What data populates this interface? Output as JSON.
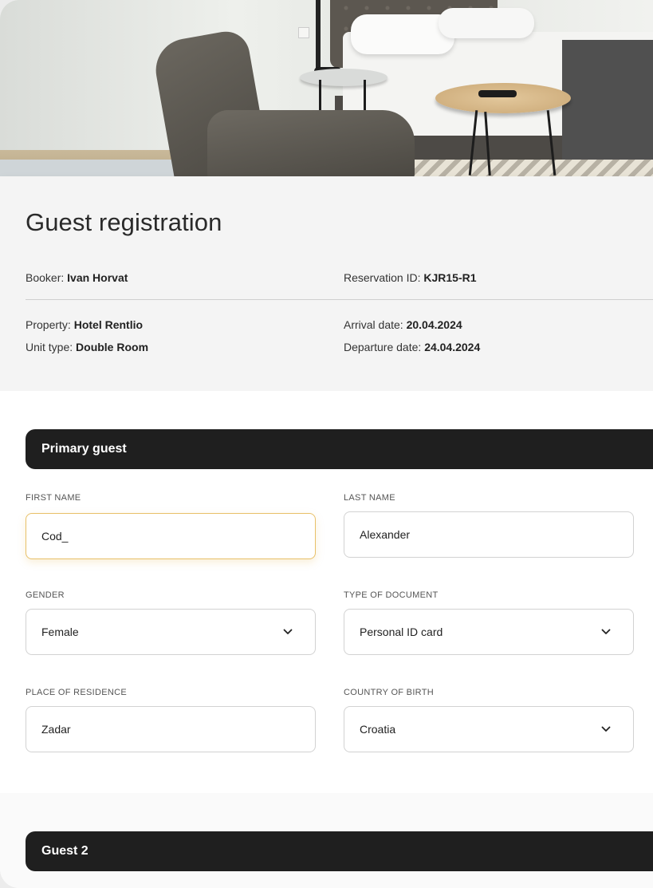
{
  "header": {
    "title": "Guest registration",
    "booker_label": "Booker:",
    "booker_value": "Ivan Horvat",
    "reservation_label": "Reservation ID:",
    "reservation_value": "KJR15-R1",
    "property_label": "Property:",
    "property_value": "Hotel Rentlio",
    "unit_label": "Unit type:",
    "unit_value": "Double Room",
    "arrival_label": "Arrival date:",
    "arrival_value": "20.04.2024",
    "departure_label": "Departure date:",
    "departure_value": "24.04.2024"
  },
  "primary_guest": {
    "section_title": "Primary guest",
    "first_name": {
      "label": "FIRST NAME",
      "value": "Cod_"
    },
    "last_name": {
      "label": "LAST NAME",
      "value": "Alexander"
    },
    "gender": {
      "label": "GENDER",
      "value": "Female"
    },
    "document_type": {
      "label": "TYPE OF DOCUMENT",
      "value": "Personal ID card"
    },
    "residence": {
      "label": "PLACE OF RESIDENCE",
      "value": "Zadar"
    },
    "country_of_birth": {
      "label": "COUNTRY OF BIRTH",
      "value": "Croatia"
    }
  },
  "guest2": {
    "section_title": "Guest 2"
  },
  "icons": {
    "dropdown": "chevron-down-icon"
  },
  "colors": {
    "section_bar": "#1f1f1f",
    "focus_border": "#e8c068",
    "info_background": "#f4f4f4"
  }
}
